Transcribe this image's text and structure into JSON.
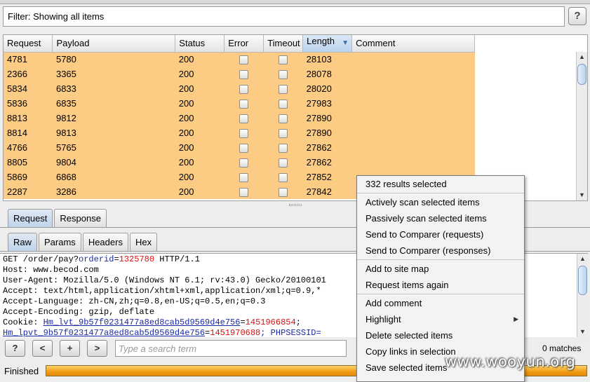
{
  "filter": {
    "text": "Filter: Showing all items",
    "help_label": "?"
  },
  "table": {
    "columns": [
      "Request",
      "Payload",
      "Status",
      "Error",
      "Timeout",
      "Length",
      "Comment"
    ],
    "sorted_column": "Length",
    "sort_icon": "sort-descending-icon",
    "row_color": "#fdcc84",
    "rows": [
      {
        "request": "4781",
        "payload": "5780",
        "status": "200",
        "error": false,
        "timeout": false,
        "length": "28103",
        "comment": ""
      },
      {
        "request": "2366",
        "payload": "3365",
        "status": "200",
        "error": false,
        "timeout": false,
        "length": "28078",
        "comment": ""
      },
      {
        "request": "5834",
        "payload": "6833",
        "status": "200",
        "error": false,
        "timeout": false,
        "length": "28020",
        "comment": ""
      },
      {
        "request": "5836",
        "payload": "6835",
        "status": "200",
        "error": false,
        "timeout": false,
        "length": "27983",
        "comment": ""
      },
      {
        "request": "8813",
        "payload": "9812",
        "status": "200",
        "error": false,
        "timeout": false,
        "length": "27890",
        "comment": ""
      },
      {
        "request": "8814",
        "payload": "9813",
        "status": "200",
        "error": false,
        "timeout": false,
        "length": "27890",
        "comment": ""
      },
      {
        "request": "4766",
        "payload": "5765",
        "status": "200",
        "error": false,
        "timeout": false,
        "length": "27862",
        "comment": ""
      },
      {
        "request": "8805",
        "payload": "9804",
        "status": "200",
        "error": false,
        "timeout": false,
        "length": "27862",
        "comment": ""
      },
      {
        "request": "5869",
        "payload": "6868",
        "status": "200",
        "error": false,
        "timeout": false,
        "length": "27852",
        "comment": ""
      },
      {
        "request": "2287",
        "payload": "3286",
        "status": "200",
        "error": false,
        "timeout": false,
        "length": "27842",
        "comment": ""
      }
    ]
  },
  "panel_tabs": {
    "items": [
      "Request",
      "Response"
    ],
    "active": "Request"
  },
  "view_tabs": {
    "items": [
      "Raw",
      "Params",
      "Headers",
      "Hex"
    ],
    "active": "Raw"
  },
  "raw_request": {
    "line1": {
      "prefix": "GET /order/pay?",
      "param_name": "orderid",
      "eq": "=",
      "param_value": "1325780",
      "suffix": " HTTP/1.1"
    },
    "line2": "Host: www.becod.com",
    "line3": "User-Agent: Mozilla/5.0 (Windows NT 6.1; rv:43.0) Gecko/20100101",
    "line4": "Accept: text/html,application/xhtml+xml,application/xml;q=0.9,*",
    "line5": "Accept-Language: zh-CN,zh;q=0.8,en-US;q=0.5,en;q=0.3",
    "line6": "Accept-Encoding: gzip, deflate",
    "line7": {
      "prefix": "Cookie: ",
      "name": "Hm_lvt_9b57f0231477a8ed8cab5d9569d4e756",
      "eq": "=",
      "value": "1451966854",
      "suffix": ";"
    },
    "line8": {
      "name": "Hm_lpvt_9b57f0231477a8ed8cab5d9569d4e756",
      "eq": "=",
      "value": "1451970688",
      "suffix": "; PHPSESSID="
    }
  },
  "search": {
    "help_label": "?",
    "prev_label": "<",
    "add_label": "+",
    "next_label": ">",
    "placeholder": "Type a search term",
    "matches": "0 matches"
  },
  "status": {
    "text": "Finished",
    "progress_fraction": 1.0,
    "progress_color": "#f19a13"
  },
  "context_menu": {
    "header": "332 results selected",
    "groups": [
      [
        "Actively scan selected items",
        "Passively scan selected items",
        "Send to Comparer (requests)",
        "Send to Comparer (responses)"
      ],
      [
        "Add to site map",
        "Request items again"
      ],
      [
        "Add comment",
        "Highlight",
        "Delete selected items",
        "Copy links in selection",
        "Save selected items"
      ]
    ],
    "submenu_item": "Highlight"
  },
  "watermark": "www.wooyun.org"
}
